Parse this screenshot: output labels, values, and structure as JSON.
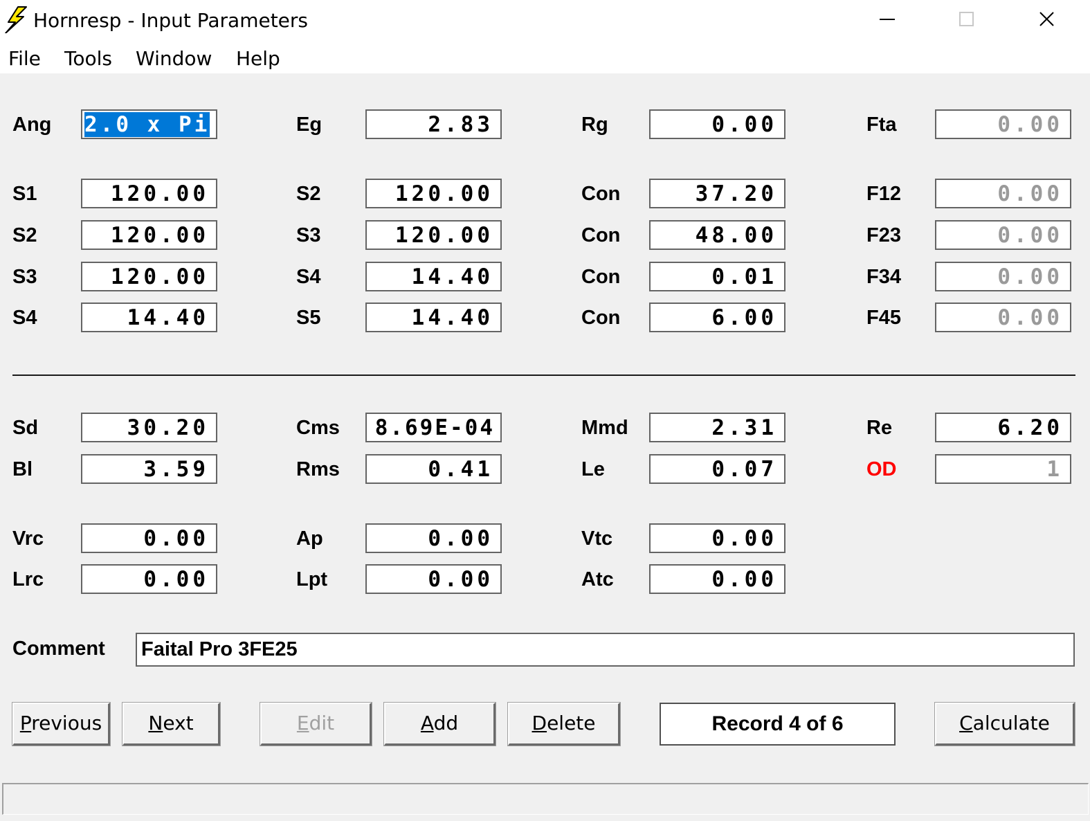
{
  "window": {
    "title": "Hornresp - Input Parameters",
    "icon": "lightning-bolt-icon",
    "controls": [
      "minimize-icon",
      "maximize-icon",
      "close-icon"
    ]
  },
  "menu": {
    "file": "File",
    "tools": "Tools",
    "window": "Window",
    "help": "Help"
  },
  "params": {
    "ang": {
      "label": "Ang",
      "value": "2.0 x Pi"
    },
    "eg": {
      "label": "Eg",
      "value": "2.83"
    },
    "rg": {
      "label": "Rg",
      "value": "0.00"
    },
    "fta": {
      "label": "Fta",
      "value": "0.00"
    },
    "s1": {
      "label": "S1",
      "value": "120.00"
    },
    "s2a": {
      "label": "S2",
      "value": "120.00"
    },
    "con1": {
      "label": "Con",
      "value": "37.20"
    },
    "f12": {
      "label": "F12",
      "value": "0.00"
    },
    "s2b": {
      "label": "S2",
      "value": "120.00"
    },
    "s3a": {
      "label": "S3",
      "value": "120.00"
    },
    "con2": {
      "label": "Con",
      "value": "48.00"
    },
    "f23": {
      "label": "F23",
      "value": "0.00"
    },
    "s3b": {
      "label": "S3",
      "value": "120.00"
    },
    "s4a": {
      "label": "S4",
      "value": "14.40"
    },
    "con3": {
      "label": "Con",
      "value": "0.01"
    },
    "f34": {
      "label": "F34",
      "value": "0.00"
    },
    "s4b": {
      "label": "S4",
      "value": "14.40"
    },
    "s5": {
      "label": "S5",
      "value": "14.40"
    },
    "con4": {
      "label": "Con",
      "value": "6.00"
    },
    "f45": {
      "label": "F45",
      "value": "0.00"
    },
    "sd": {
      "label": "Sd",
      "value": "30.20"
    },
    "cms": {
      "label": "Cms",
      "value": "8.69E-04"
    },
    "mmd": {
      "label": "Mmd",
      "value": "2.31"
    },
    "re": {
      "label": "Re",
      "value": "6.20"
    },
    "bl": {
      "label": "Bl",
      "value": "3.59"
    },
    "rms": {
      "label": "Rms",
      "value": "0.41"
    },
    "le": {
      "label": "Le",
      "value": "0.07"
    },
    "od": {
      "label": "OD",
      "value": "1"
    },
    "vrc": {
      "label": "Vrc",
      "value": "0.00"
    },
    "ap": {
      "label": "Ap",
      "value": "0.00"
    },
    "vtc": {
      "label": "Vtc",
      "value": "0.00"
    },
    "lrc": {
      "label": "Lrc",
      "value": "0.00"
    },
    "lpt": {
      "label": "Lpt",
      "value": "0.00"
    },
    "atc": {
      "label": "Atc",
      "value": "0.00"
    }
  },
  "comment": {
    "label": "Comment",
    "value": "Faital Pro 3FE25"
  },
  "buttons": {
    "previous": {
      "mnemonic": "P",
      "rest": "revious"
    },
    "next": {
      "mnemonic": "N",
      "rest": "ext"
    },
    "edit": {
      "mnemonic": "E",
      "rest": "dit"
    },
    "add": {
      "mnemonic": "A",
      "rest": "dd"
    },
    "delete": {
      "mnemonic": "D",
      "rest": "elete"
    },
    "calculate": {
      "mnemonic": "C",
      "rest": "alculate"
    }
  },
  "record": "Record 4 of 6",
  "colors": {
    "od_label": "#ff0000",
    "selection": "#0078d7",
    "disabled_text": "#9a9a9a"
  }
}
